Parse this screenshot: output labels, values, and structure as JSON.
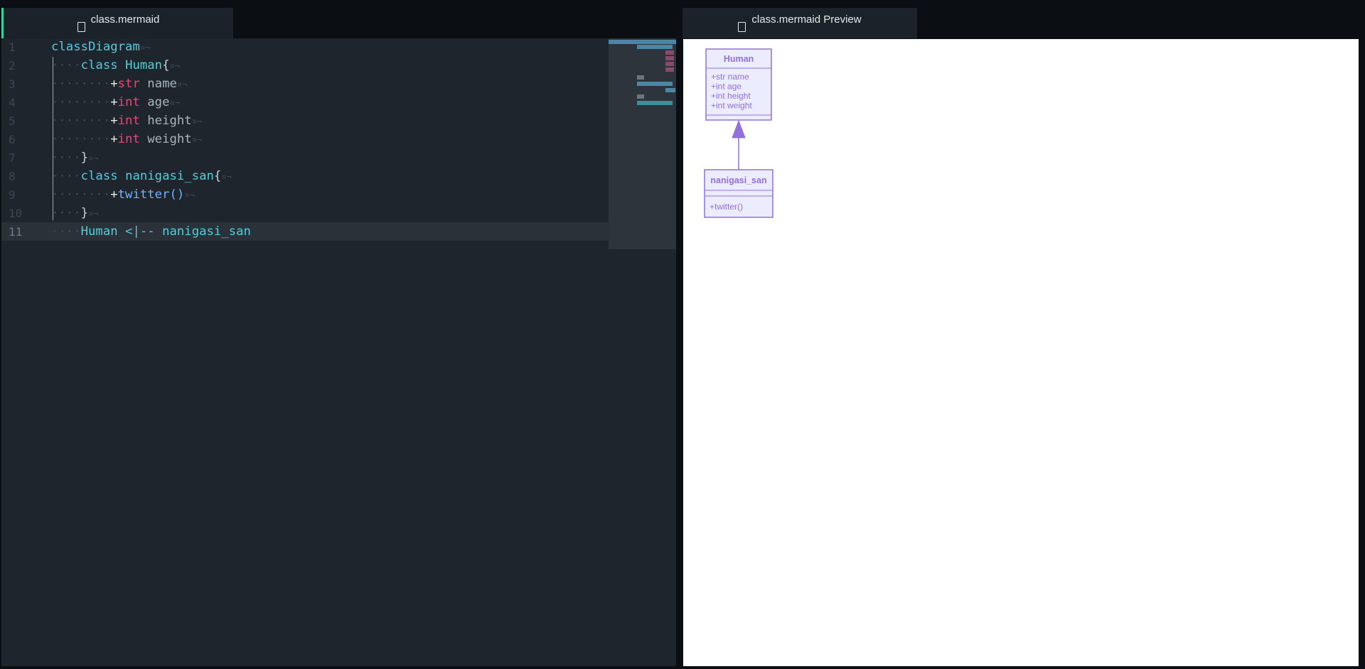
{
  "tabs": {
    "editor_title": "class.mermaid",
    "preview_title": "class.mermaid Preview"
  },
  "editor": {
    "current_line": 11,
    "lines": [
      {
        "no": "1",
        "ws": "",
        "parts": [
          [
            "kw",
            "classDiagram"
          ],
          [
            "eol",
            "¤¬"
          ]
        ]
      },
      {
        "no": "2",
        "ws": "····",
        "parts": [
          [
            "kw",
            "class "
          ],
          [
            "cls",
            "Human"
          ],
          [
            "brace",
            "{"
          ],
          [
            "eol",
            "¤¬"
          ]
        ]
      },
      {
        "no": "3",
        "ws": "········",
        "parts": [
          [
            "plus",
            "+"
          ],
          [
            "typ",
            "str"
          ],
          [
            "code",
            " name"
          ],
          [
            "eol",
            "¤¬"
          ]
        ]
      },
      {
        "no": "4",
        "ws": "········",
        "parts": [
          [
            "plus",
            "+"
          ],
          [
            "typ",
            "int"
          ],
          [
            "code",
            " age"
          ],
          [
            "eol",
            "¤¬"
          ]
        ]
      },
      {
        "no": "5",
        "ws": "········",
        "parts": [
          [
            "plus",
            "+"
          ],
          [
            "typ",
            "int"
          ],
          [
            "code",
            " height"
          ],
          [
            "eol",
            "¤¬"
          ]
        ]
      },
      {
        "no": "6",
        "ws": "········",
        "parts": [
          [
            "plus",
            "+"
          ],
          [
            "typ",
            "int"
          ],
          [
            "code",
            " weight"
          ],
          [
            "eol",
            "¤¬"
          ]
        ]
      },
      {
        "no": "7",
        "ws": "····",
        "parts": [
          [
            "brace",
            "}"
          ],
          [
            "eol",
            "¤¬"
          ]
        ]
      },
      {
        "no": "8",
        "ws": "····",
        "parts": [
          [
            "kw",
            "class "
          ],
          [
            "cls",
            "nanigasi_san"
          ],
          [
            "brace",
            "{"
          ],
          [
            "eol",
            "¤¬"
          ]
        ]
      },
      {
        "no": "9",
        "ws": "········",
        "parts": [
          [
            "plus",
            "+"
          ],
          [
            "fn",
            "twitter()"
          ],
          [
            "eol",
            "¤¬"
          ]
        ]
      },
      {
        "no": "10",
        "ws": "····",
        "parts": [
          [
            "brace",
            "}"
          ],
          [
            "eol",
            "¤¬"
          ]
        ]
      },
      {
        "no": "11",
        "ws": "····",
        "parts": [
          [
            "cls",
            "Human "
          ],
          [
            "rel",
            "<|-- "
          ],
          [
            "cls",
            "nanigasi_san"
          ]
        ]
      }
    ]
  },
  "diagram": {
    "colors": {
      "stroke": "#9370db",
      "fill": "#ececff",
      "text": "#9370db"
    },
    "classes": [
      {
        "name": "Human",
        "members": [
          "+str name",
          "+int age",
          "+int height",
          "+int weight"
        ],
        "methods": []
      },
      {
        "name": "nanigasi_san",
        "members": [],
        "methods": [
          "+twitter()"
        ]
      }
    ],
    "relation": {
      "from": "nanigasi_san",
      "to": "Human",
      "type": "inheritance"
    }
  }
}
